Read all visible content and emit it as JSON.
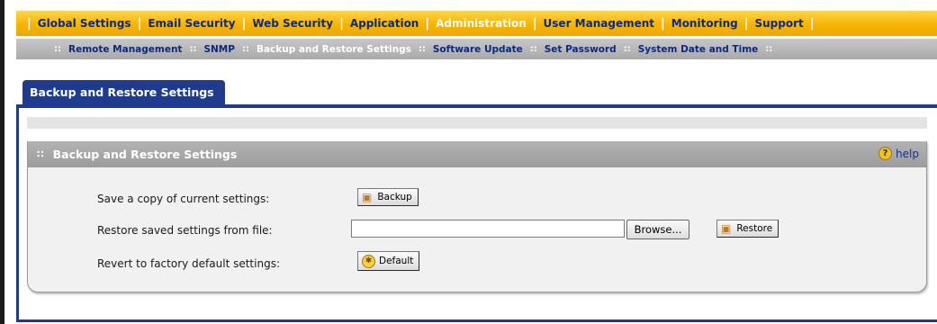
{
  "top_nav": {
    "items": [
      "Global Settings",
      "Email Security",
      "Web Security",
      "Application",
      "Administration",
      "User Management",
      "Monitoring",
      "Support"
    ],
    "active_index": 4
  },
  "sub_nav": {
    "items": [
      "Remote Management",
      "SNMP",
      "Backup and Restore Settings",
      "Software Update",
      "Set Password",
      "System Date and Time"
    ],
    "active_index": 2
  },
  "tab": {
    "label": "Backup and Restore Settings"
  },
  "section": {
    "title": "Backup and Restore Settings",
    "help_label": "help"
  },
  "rows": {
    "save_label": "Save a copy of current settings:",
    "restore_label": "Restore saved settings from file:",
    "revert_label": "Revert to factory default settings:"
  },
  "buttons": {
    "backup": "Backup",
    "browse": "Browse...",
    "restore": "Restore",
    "default": "Default"
  },
  "file_input": {
    "value": ""
  },
  "icons": {
    "grip": "grip-icon",
    "help": "help-icon",
    "backup": "disk-icon",
    "restore": "restore-icon",
    "default": "default-icon"
  },
  "colors": {
    "accent": "#1f3b8f",
    "nav_orange": "#f6b400",
    "nav_text": "#0a2a80",
    "active_text": "#ffffff"
  }
}
